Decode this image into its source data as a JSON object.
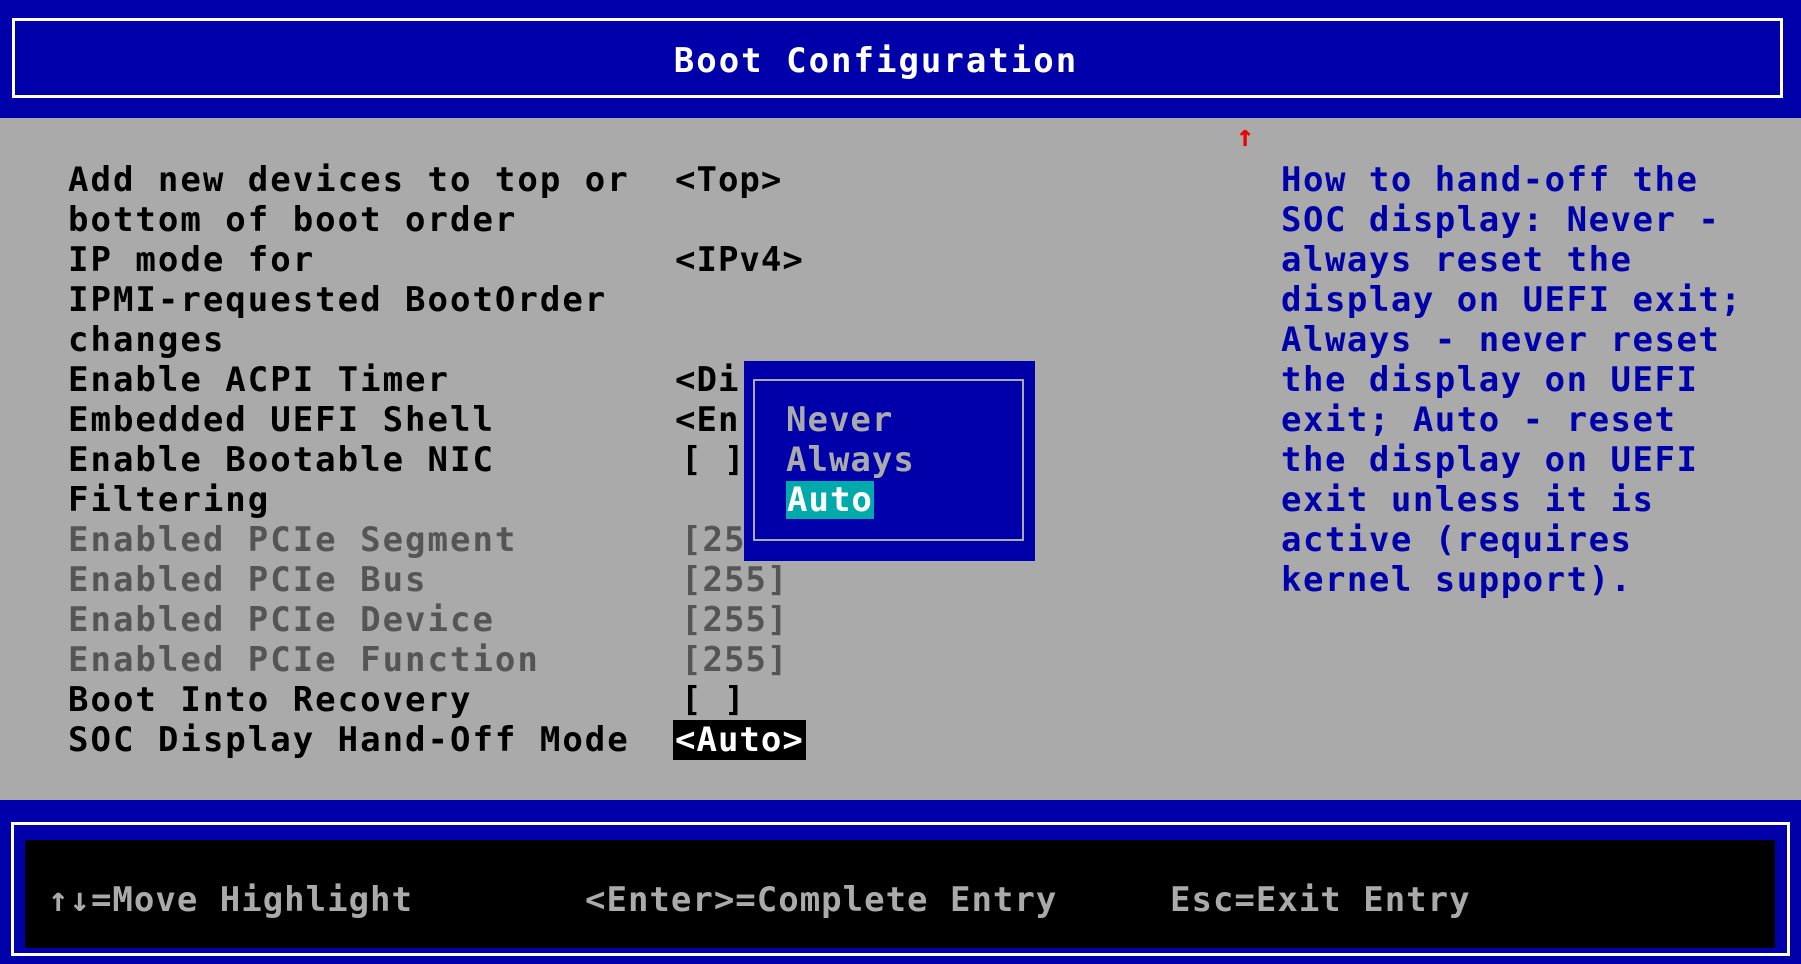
{
  "title": "Boot Configuration",
  "scroll_indicator": "↑",
  "options": [
    {
      "label": "Add new devices to top or\nbottom of boot order",
      "value": "<Top>"
    },
    {
      "label": "IP mode for\nIPMI-requested BootOrder\nchanges",
      "value": "<IPv4>"
    },
    {
      "label": "Enable ACPI Timer",
      "value": "<Di"
    },
    {
      "label": "Embedded UEFI Shell",
      "value": "<En"
    },
    {
      "label": "Enable Bootable NIC\nFiltering",
      "value": "[ ]"
    },
    {
      "label": "Enabled PCIe Segment",
      "value": "[25"
    },
    {
      "label": "Enabled PCIe Bus",
      "value": "[255]"
    },
    {
      "label": "Enabled PCIe Device",
      "value": "[255]"
    },
    {
      "label": "Enabled PCIe Function",
      "value": "[255]"
    },
    {
      "label": "Boot Into Recovery",
      "value": "[ ]"
    },
    {
      "label": "SOC Display Hand-Off Mode",
      "value": "<Auto>"
    }
  ],
  "help_text": [
    "How to hand-off the",
    "SOC display: Never -",
    "always reset the",
    "display on UEFI exit;",
    "Always - never reset",
    "the display on UEFI",
    "exit; Auto - reset",
    "the display on UEFI",
    "exit unless it is",
    "active (requires",
    "kernel support)."
  ],
  "popup": {
    "options": [
      "Never",
      "Always",
      "Auto"
    ],
    "selected": "Auto"
  },
  "footer": {
    "move": "↑↓=Move Highlight",
    "enter": "<Enter>=Complete Entry",
    "esc": "Esc=Exit Entry"
  },
  "colors": {
    "background": "#aaaaaa",
    "bar": "#0000aa",
    "help_text": "#0000aa",
    "popup_highlight": "#00aaaa",
    "scroll_arrow": "#ee0000"
  }
}
